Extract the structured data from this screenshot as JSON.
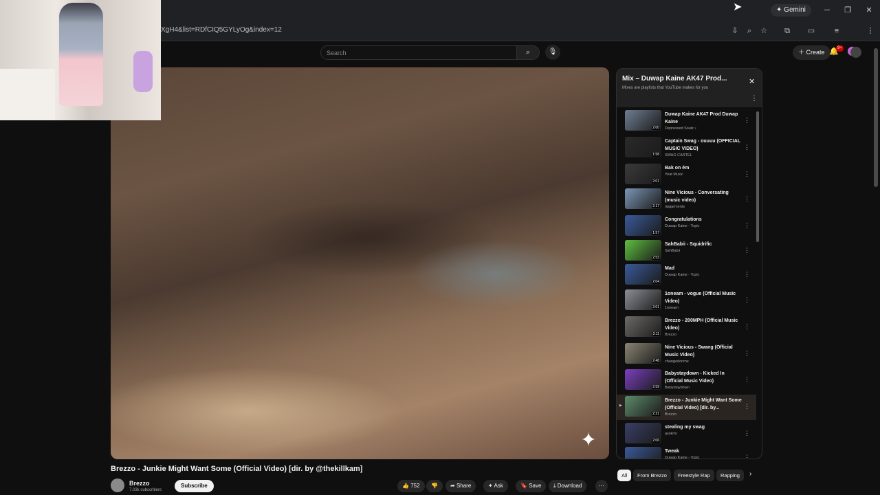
{
  "browser": {
    "assistant_label": "Gemini",
    "url": "XgH4&list=RDfCIQ5GYLyOg&index=12"
  },
  "header": {
    "search_placeholder": "Search",
    "create_label": "Create",
    "notification_count": "9+"
  },
  "video": {
    "title": "Brezzo - Junkie Might Want Some (Official Video) [dir. by @thekillkam]",
    "channel": "Brezzo",
    "subscribers": "7.03k subscribers",
    "subscribe_label": "Subscribe",
    "likes": "752",
    "share_label": "Share",
    "ask_label": "Ask",
    "save_label": "Save",
    "download_label": "Download"
  },
  "playlist": {
    "title": "Mix – Duwap Kaine AK47 Prod...",
    "subtitle": "Mixes are playlists that YouTube makes for you",
    "items": [
      {
        "title": "Duwap Kaine AK47 Prod Duwap Kaine",
        "channel": "Depressed Soulz ♪",
        "duration": "2:00",
        "color": "#6f7d92"
      },
      {
        "title": "Captain Swag - ouuuu (OFFICIAL MUSIC VIDEO)",
        "channel": "SWAG CARTEL",
        "duration": "1:58",
        "color": "#2a2a2a"
      },
      {
        "title": "Bak on ém",
        "channel": "Yeat Music",
        "duration": "2:01",
        "color": "#3a3a3a"
      },
      {
        "title": "Nine Vicious - Conversating (music video)",
        "channel": "ripgarments",
        "duration": "2:17",
        "color": "#7b96b5"
      },
      {
        "title": "Congratulations",
        "channel": "Duwap Kaine - Topic",
        "duration": "1:57",
        "color": "#3a5a9a"
      },
      {
        "title": "SahBabii - Squidrific",
        "channel": "SahBabii",
        "duration": "2:53",
        "color": "#5fbf3f"
      },
      {
        "title": "Mad",
        "channel": "Duwap Kaine - Topic",
        "duration": "2:04",
        "color": "#3a5a9a"
      },
      {
        "title": "1oneam - vogue (Official Music Video)",
        "channel": "1oneam",
        "duration": "2:01",
        "color": "#8a8f96"
      },
      {
        "title": "Brezzo - 200MPH (Official Music Video)",
        "channel": "Brezzo",
        "duration": "2:11",
        "color": "#6d6a66"
      },
      {
        "title": "Nine Vicious - Swang (Official Music Video)",
        "channel": "changedonme",
        "duration": "2:48",
        "color": "#8a8473"
      },
      {
        "title": "Babystaydown - Kicked In (Official Music Video)",
        "channel": "Babystaydown",
        "duration": "2:59",
        "color": "#7a3fc0"
      },
      {
        "title": "Brezzo - Junkie Might Want Some (Official Video) [dir. by...",
        "channel": "Brezzo",
        "duration": "2:21",
        "color": "#5d8a6a"
      },
      {
        "title": "stealing my swag",
        "channel": "asskrto",
        "duration": "2:06",
        "color": "#3a3f66"
      },
      {
        "title": "Tweak",
        "channel": "Duwap Kaine - Topic",
        "duration": "",
        "color": "#3a5a9a"
      }
    ],
    "active_index": 11
  },
  "chips": [
    "All",
    "From Brezzo",
    "Freestyle Rap",
    "Rapping"
  ]
}
